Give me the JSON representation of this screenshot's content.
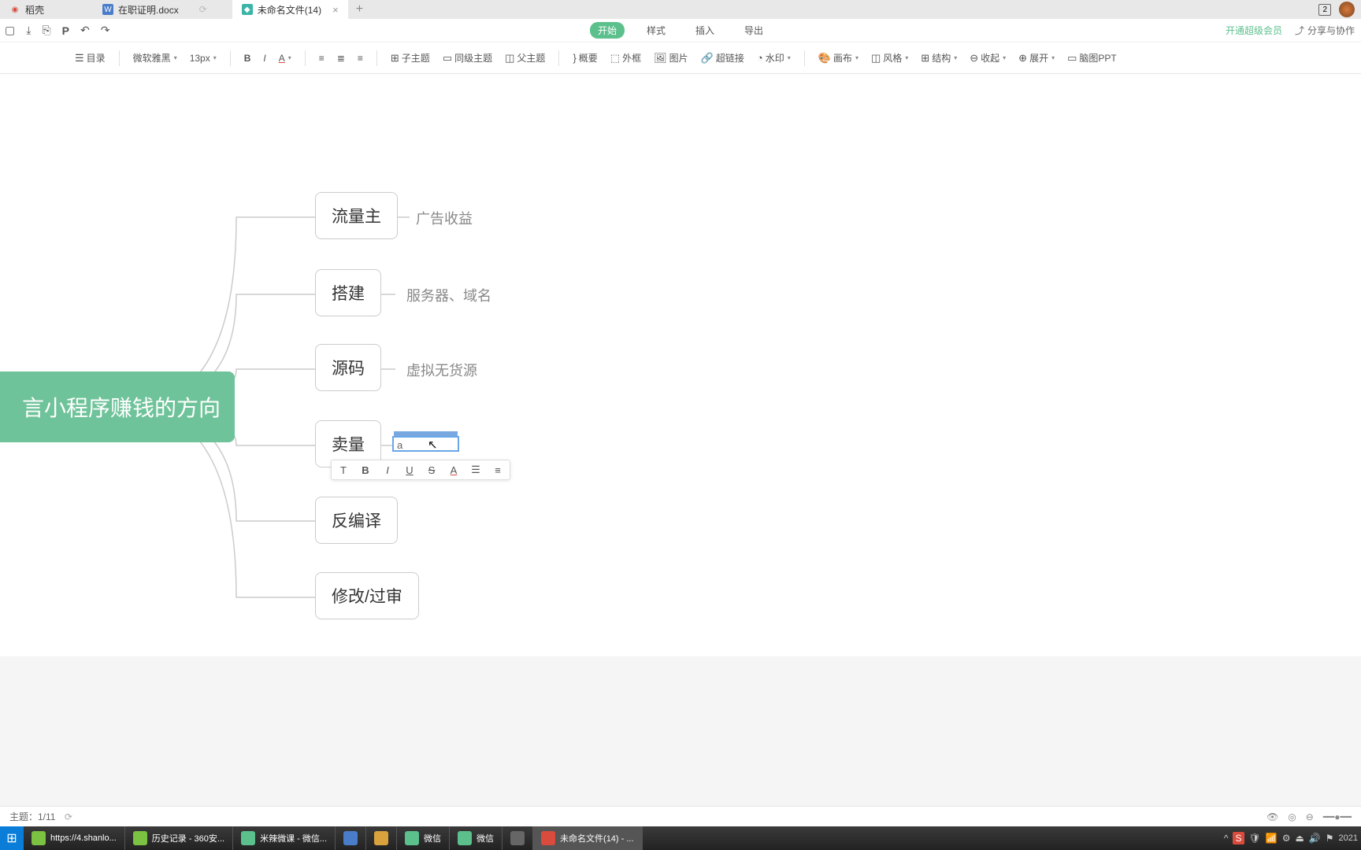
{
  "tabs": {
    "items": [
      {
        "label": "稻壳",
        "icon": "red"
      },
      {
        "label": "在职证明.docx",
        "icon": "blue"
      },
      {
        "label": "未命名文件(14)",
        "icon": "teal",
        "active": true
      }
    ],
    "badge": "2"
  },
  "menu": {
    "start": "开始",
    "style": "样式",
    "insert": "插入",
    "export": "导出",
    "vip": "开通超级会员",
    "share": "分享与协作"
  },
  "toolbar": {
    "outline": "目录",
    "font": "微软雅黑",
    "size": "13px",
    "subtopic": "子主题",
    "sametopic": "同级主题",
    "parenttopic": "父主题",
    "summary": "概要",
    "border": "外框",
    "image": "图片",
    "link": "超链接",
    "watermark": "水印",
    "canvas": "画布",
    "style": "风格",
    "structure": "结构",
    "collapse": "收起",
    "expand": "展开",
    "brain": "脑图PPT"
  },
  "mindmap": {
    "central": "言小程序赚钱的方向",
    "nodes": [
      {
        "label": "流量主",
        "sub": "广告收益"
      },
      {
        "label": "搭建",
        "sub": "服务器、域名"
      },
      {
        "label": "源码",
        "sub": "虚拟无货源"
      },
      {
        "label": "卖量",
        "editing": "a"
      },
      {
        "label": "反编译"
      },
      {
        "label": "修改/过审"
      }
    ]
  },
  "status": {
    "topic": "主题：1/11"
  },
  "taskbar": {
    "items": [
      {
        "label": "https://4.shanlo...",
        "icon": "#7bc142"
      },
      {
        "label": "历史记录 - 360安...",
        "icon": "#7bc142"
      },
      {
        "label": "米辣微课 - 微信...",
        "icon": "#5cc08d"
      },
      {
        "label": "",
        "icon": "#4a7dc9"
      },
      {
        "label": "",
        "icon": "#d9a23c"
      },
      {
        "label": "微信",
        "icon": "#5cc08d"
      },
      {
        "label": "微信",
        "icon": "#5cc08d"
      },
      {
        "label": "",
        "icon": "#666"
      },
      {
        "label": "未命名文件(14) - ...",
        "icon": "#d94b3c",
        "active": true
      }
    ],
    "year": "2021"
  }
}
